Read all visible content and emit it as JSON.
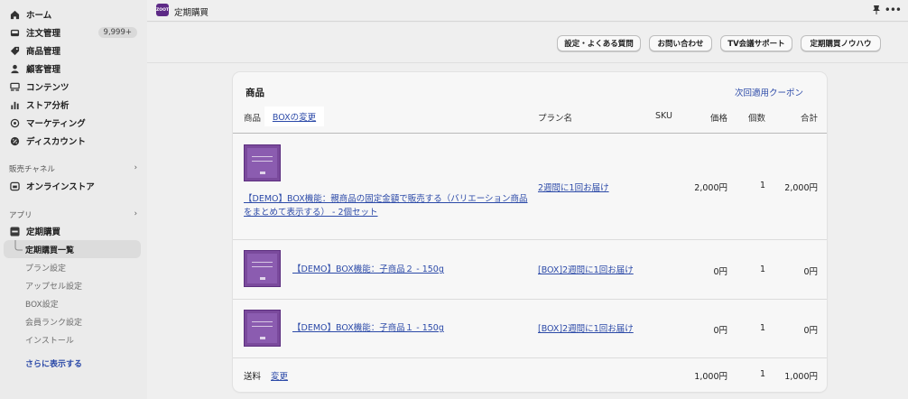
{
  "sidebar": {
    "items": [
      {
        "label": "ホーム",
        "icon": "home-icon"
      },
      {
        "label": "注文管理",
        "icon": "inbox-icon",
        "badge": "9,999+"
      },
      {
        "label": "商品管理",
        "icon": "tag-icon"
      },
      {
        "label": "顧客管理",
        "icon": "person-icon"
      },
      {
        "label": "コンテンツ",
        "icon": "content-icon"
      },
      {
        "label": "ストア分析",
        "icon": "bar-chart-icon"
      },
      {
        "label": "マーケティング",
        "icon": "target-icon"
      },
      {
        "label": "ディスカウント",
        "icon": "gear-badge-icon"
      }
    ],
    "sales_channels": {
      "heading": "販売チャネル",
      "online_store": "オンラインストア"
    },
    "apps": {
      "heading": "アプリ",
      "app_name": "定期購買",
      "sub_items": [
        "定期購買一覧",
        "プラン設定",
        "アップセル設定",
        "BOX設定",
        "会員ランク設定",
        "インストール"
      ],
      "more": "さらに表示する"
    }
  },
  "topbar": {
    "logo_text": "ZOOT",
    "title": "定期購買"
  },
  "header_buttons": [
    "設定・よくある質問",
    "お問い合わせ",
    "TV会議サポート",
    "定期購買ノウハウ"
  ],
  "card": {
    "title": "商品",
    "coupon_link": "次回適用クーポン",
    "columns": {
      "product": "商品",
      "box_change": "BOXの変更",
      "plan": "プラン名",
      "sku": "SKU",
      "price": "価格",
      "qty": "個数",
      "total": "合計"
    },
    "rows": [
      {
        "product": "【DEMO】BOX機能：親商品の固定金額で販売する（バリエーション商品をまとめて表示する） - 2個セット",
        "plan": "2週間に1回お届け",
        "price": "2,000円",
        "qty": "1",
        "total": "2,000円"
      },
      {
        "product": "【DEMO】BOX機能：子商品２ - 150g",
        "plan": "[BOX]2週間に1回お届け",
        "price": "0円",
        "qty": "1",
        "total": "0円"
      },
      {
        "product": "【DEMO】BOX機能：子商品１ - 150g",
        "plan": "[BOX]2週間に1回お届け",
        "price": "0円",
        "qty": "1",
        "total": "0円"
      }
    ],
    "shipping": {
      "label": "送料",
      "change": "変更",
      "price": "1,000円",
      "qty": "1",
      "total": "1,000円"
    }
  }
}
